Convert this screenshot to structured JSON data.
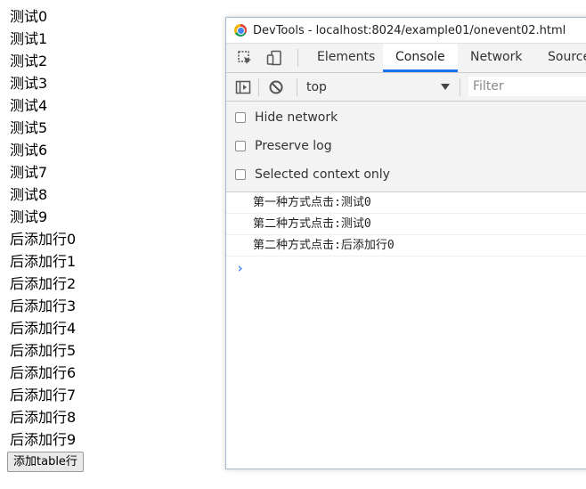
{
  "page": {
    "list_items": [
      "测试0",
      "测试1",
      "测试2",
      "测试3",
      "测试4",
      "测试5",
      "测试6",
      "测试7",
      "测试8",
      "测试9",
      "后添加行0",
      "后添加行1",
      "后添加行2",
      "后添加行3",
      "后添加行4",
      "后添加行5",
      "后添加行6",
      "后添加行7",
      "后添加行8",
      "后添加行9"
    ],
    "add_button_label": "添加table行"
  },
  "devtools": {
    "title": "DevTools - localhost:8024/example01/onevent02.html",
    "tabs": {
      "elements": "Elements",
      "console": "Console",
      "network": "Network",
      "sources": "Source"
    },
    "toolbar": {
      "context": "top",
      "filter_placeholder": "Filter"
    },
    "settings": {
      "hide_network": "Hide network",
      "preserve_log": "Preserve log",
      "selected_context_only": "Selected context only"
    },
    "messages": [
      "第一种方式点击:测试0",
      "第二种方式点击:测试0",
      "第二种方式点击:后添加行0"
    ],
    "accent_color": "#1a73e8",
    "prompt_color": "#367cf1"
  }
}
